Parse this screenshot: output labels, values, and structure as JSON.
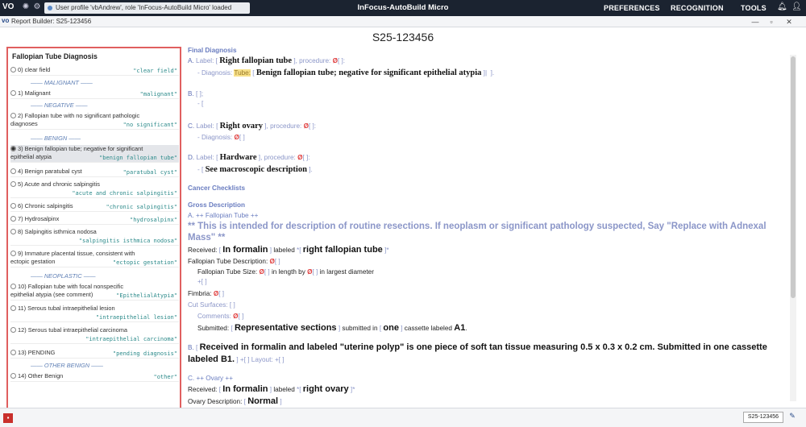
{
  "topbar": {
    "logo": "VO",
    "status_text": "User profile 'vbAndrew', role 'InFocus-AutoBuild Micro' loaded",
    "app_title": "InFocus-AutoBuild Micro",
    "menu": [
      "PREFERENCES",
      "RECOGNITION",
      "TOOLS"
    ]
  },
  "window": {
    "logo": "vo",
    "title": "Report Builder: S25-123456",
    "case_id": "S25-123456"
  },
  "left_panel": {
    "title": "Fallopian Tube Diagnosis",
    "items": [
      {
        "text": "0) clear field",
        "code": "\"clear field\""
      },
      {
        "section": "—— MALIGNANT ——"
      },
      {
        "text": "1) Malignant",
        "code": "\"malignant\""
      },
      {
        "section": "—— NEGATIVE ——"
      },
      {
        "text": "2) Fallopian tube with no significant pathologic",
        "text2": "diagnoses",
        "code": "\"no significant\""
      },
      {
        "section": "—— BENIGN ——"
      },
      {
        "text": "3) Benign fallopian tube; negative for significant",
        "text2": "epithelial atypia",
        "code": "\"benign fallopian tube\"",
        "selected": true
      },
      {
        "text": "4) Benign paratubal cyst",
        "code": "\"paratubal cyst\""
      },
      {
        "text": "5) Acute and chronic salpingitis",
        "code2": "\"acute and chronic salpingitis\""
      },
      {
        "text": "6) Chronic salpingitis",
        "code": "\"chronic salpingitis\""
      },
      {
        "text": "7) Hydrosalpinx",
        "code": "\"hydrosalpinx\""
      },
      {
        "text": "8) Salpingitis isthmica nodosa",
        "code2": "\"salpingitis isthmica nodosa\""
      },
      {
        "text": "9) Immature placental tissue, consistent with",
        "text2": "ectopic gestation",
        "code": "\"ectopic gestation\""
      },
      {
        "section": "—— NEOPLASTIC ——"
      },
      {
        "text": "10) Fallopian tube with focal nonspecific",
        "text2": "epithelial atypia (see comment)",
        "code": "\"EpithelialAtypia\""
      },
      {
        "text": "11) Serous tubal intraepithelial lesion",
        "code2": "\"intraepithelial lesion\""
      },
      {
        "text": "12) Serous tubal intraepithelial carcinoma",
        "code2": "\"intraepithelial carcinoma\""
      },
      {
        "text": "13) PENDING",
        "code": "\"pending diagnosis\""
      },
      {
        "section": "—— OTHER BENIGN ——"
      },
      {
        "text": "14) Other Benign",
        "code": "\"other\""
      }
    ]
  },
  "report": {
    "final_diagnosis_heading": "Final Diagnosis",
    "A": {
      "letter": "A.",
      "label_word": "Label:",
      "label_value": "Right fallopian tube",
      "procedure_word": "procedure:",
      "diagnosis_word": "- Diagnosis:",
      "tube_tag": "Tube:",
      "diagnosis_value": "Benign fallopian tube; negative for significant epithelial atypia"
    },
    "B": {
      "letter": "B."
    },
    "C": {
      "letter": "C.",
      "label_word": "Label:",
      "label_value": "Right ovary",
      "procedure_word": "procedure:",
      "diagnosis_word": "- Diagnosis:"
    },
    "D": {
      "letter": "D.",
      "label_word": "Label:",
      "label_value": "Hardware",
      "procedure_word": "procedure:",
      "line2": "See macroscopic description"
    },
    "cancer_checklists": "Cancer Checklists",
    "gross_heading": "Gross Description",
    "gross_A_title": "A. ++ Fallopian Tube ++",
    "gross_note": "** This is intended for description of routine resections. If neoplasm or significant pathology suspected, Say \"Replace with Adnexal Mass\" **",
    "received_label": "Received:",
    "in_formalin": "In formalin",
    "labeled_word": "labeled",
    "labeled_value": "right fallopian tube",
    "ft_description": "Fallopian Tube Description:",
    "ft_size": "Fallopian Tube Size:",
    "in_length_by": "in length by",
    "in_largest_diameter": "in largest diameter",
    "fimbria": "Fimbria:",
    "cut_surfaces": "Cut Surfaces:",
    "comments": "Comments:",
    "submitted_label": "Submitted:",
    "representative_sections": "Representative sections",
    "submitted_in": "submitted in",
    "one": "one",
    "cassette_labeled": "cassette labeled",
    "a1": "A1",
    "gross_B_letter": "B.",
    "gross_B_text": "Received in formalin and labeled \"uterine polyp\" is one piece of soft tan tissue measuring 0.5 x 0.3 x 0.2 cm. Submitted in one cassette labeled B1.",
    "layout_word": "Layout:",
    "gross_C_title": "C. ++ Ovary ++",
    "labeled_value_c": "right ovary",
    "ovary_description": "Ovary Description:",
    "normal": "Normal"
  },
  "bottombar": {
    "case_id": "S25-123456"
  }
}
